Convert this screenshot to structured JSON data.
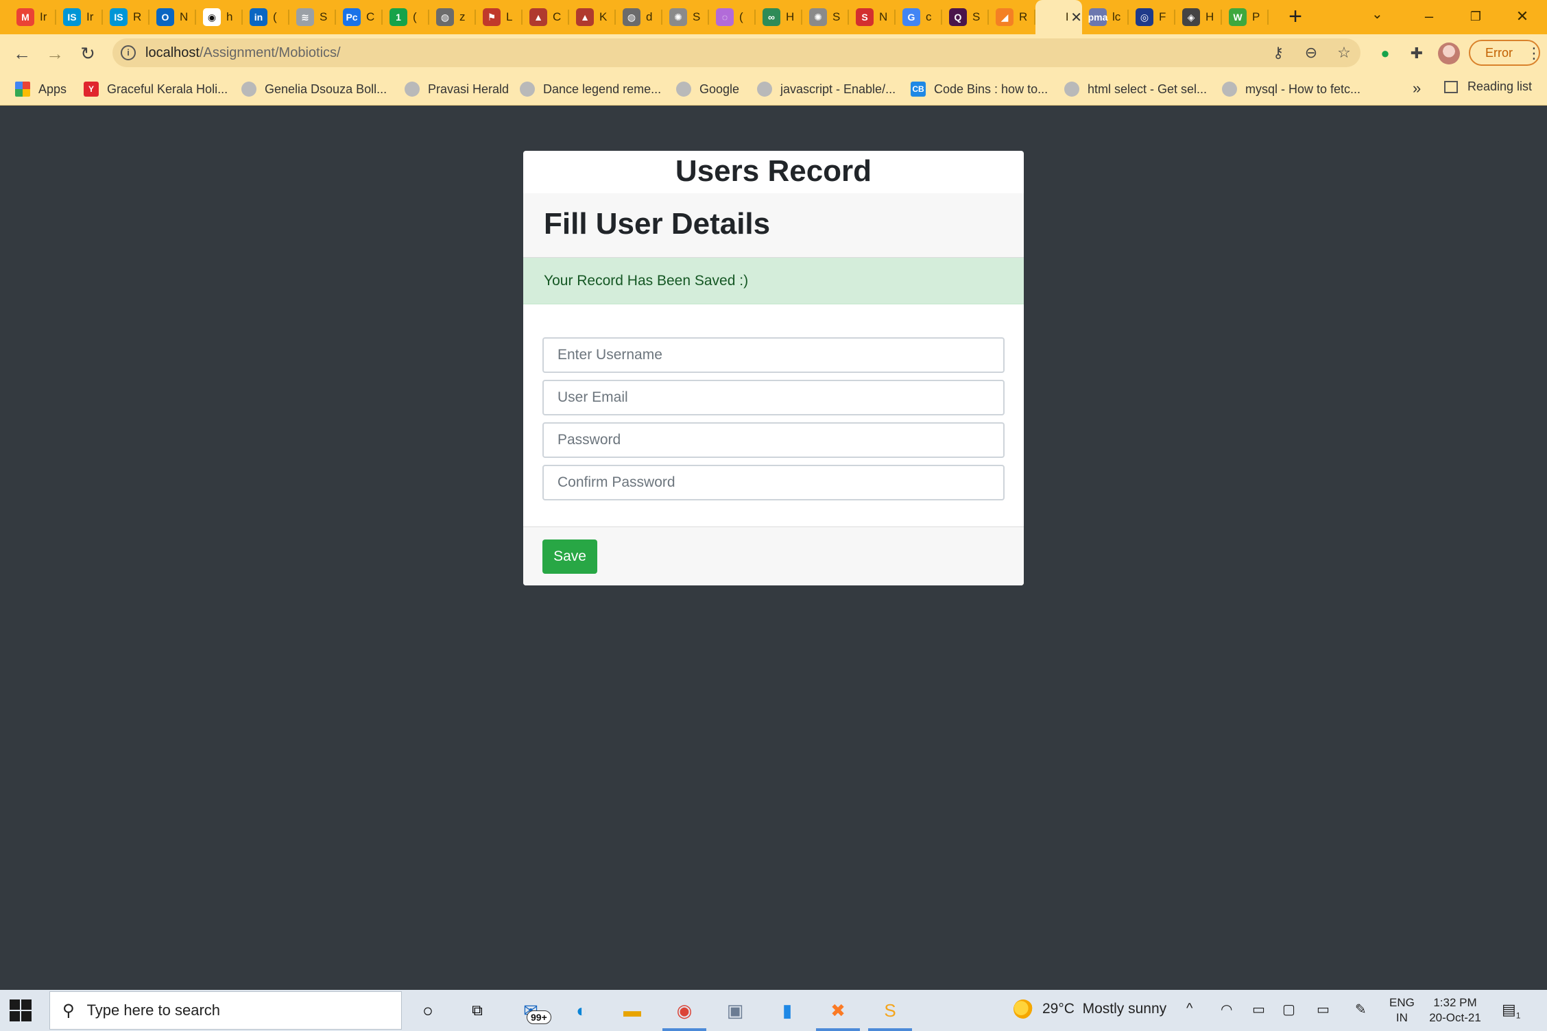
{
  "browser": {
    "tabs": [
      {
        "fav": "M",
        "color": "#ea4335",
        "label": "Ir",
        "icon": "gmail-icon"
      },
      {
        "fav": "IS",
        "color": "#0096d6",
        "label": "Ir",
        "icon": "is-icon"
      },
      {
        "fav": "IS",
        "color": "#0096d6",
        "label": "R",
        "icon": "is-icon"
      },
      {
        "fav": "O",
        "color": "#0a66c2",
        "label": "N",
        "icon": "outlook-icon"
      },
      {
        "fav": "◉",
        "color": "#ffffff",
        "label": "h",
        "icon": "github-icon"
      },
      {
        "fav": "in",
        "color": "#0a66c2",
        "label": "(",
        "icon": "linkedin-icon"
      },
      {
        "fav": "≋",
        "color": "#9aa0a6",
        "label": "S",
        "icon": "site-icon"
      },
      {
        "fav": "Pc",
        "color": "#1a73e8",
        "label": "C",
        "icon": "site-icon"
      },
      {
        "fav": "1",
        "color": "#16a34a",
        "label": "(",
        "icon": "whatsapp-icon"
      },
      {
        "fav": "◍",
        "color": "#6b6b6b",
        "label": "z",
        "icon": "globe-icon"
      },
      {
        "fav": "⚑",
        "color": "#c0392b",
        "label": "L",
        "icon": "site-icon"
      },
      {
        "fav": "▲",
        "color": "#b03a2e",
        "label": "C",
        "icon": "site-icon"
      },
      {
        "fav": "▲",
        "color": "#b03a2e",
        "label": "K",
        "icon": "site-icon"
      },
      {
        "fav": "◍",
        "color": "#6b6b6b",
        "label": "d",
        "icon": "globe-icon"
      },
      {
        "fav": "✺",
        "color": "#8a8a8a",
        "label": "S",
        "icon": "emblem-icon"
      },
      {
        "fav": "◌",
        "color": "#b26bd9",
        "label": "(",
        "icon": "site-icon"
      },
      {
        "fav": "∞",
        "color": "#2e8b57",
        "label": "H",
        "icon": "site-icon"
      },
      {
        "fav": "✺",
        "color": "#8a8a8a",
        "label": "S",
        "icon": "emblem-icon"
      },
      {
        "fav": "S",
        "color": "#d32f2f",
        "label": "N",
        "icon": "site-icon"
      },
      {
        "fav": "G",
        "color": "#4285f4",
        "label": "c",
        "icon": "google-icon"
      },
      {
        "fav": "Q",
        "color": "#4a154b",
        "label": "S",
        "icon": "site-icon"
      },
      {
        "fav": "◢",
        "color": "#f48024",
        "label": "R",
        "icon": "stackoverflow-icon"
      },
      {
        "fav": "",
        "color": "transparent",
        "label": "Re",
        "icon": "page-icon",
        "active": true
      },
      {
        "fav": "pma",
        "color": "#6c78af",
        "label": "lc",
        "icon": "phpmyadmin-icon"
      },
      {
        "fav": "◎",
        "color": "#1e3a8a",
        "label": "F",
        "icon": "site-icon"
      },
      {
        "fav": "◈",
        "color": "#444444",
        "label": "H",
        "icon": "site-icon"
      },
      {
        "fav": "W",
        "color": "#3ea83e",
        "label": "P",
        "icon": "site-icon"
      }
    ],
    "url_host": "localhost",
    "url_path": "/Assignment/Mobiotics/",
    "error_label": "Error",
    "bookmarks": [
      {
        "label": "Apps",
        "icon": "apps-grid-icon"
      },
      {
        "label": "Graceful Kerala Holi...",
        "icon": "yahoo-icon"
      },
      {
        "label": "Genelia Dsouza Boll...",
        "icon": "globe-icon"
      },
      {
        "label": "Pravasi Herald",
        "icon": "globe-icon"
      },
      {
        "label": "Dance legend reme...",
        "icon": "globe-icon"
      },
      {
        "label": "Google",
        "icon": "globe-icon"
      },
      {
        "label": "javascript - Enable/...",
        "icon": "globe-icon"
      },
      {
        "label": "Code Bins : how to...",
        "icon": "codebins-icon"
      },
      {
        "label": "html select - Get sel...",
        "icon": "globe-icon"
      },
      {
        "label": "mysql - How to fetc...",
        "icon": "globe-icon"
      }
    ],
    "reading_list": "Reading list"
  },
  "page": {
    "title": "Users Record",
    "card_header": "Fill User Details",
    "alert": "Your Record Has Been Saved :)",
    "fields": {
      "username_placeholder": "Enter Username",
      "email_placeholder": "User Email",
      "password_placeholder": "Password",
      "confirm_placeholder": "Confirm Password"
    },
    "save_label": "Save",
    "colors": {
      "background": "#343a40",
      "save_button": "#28a745",
      "alert_bg": "#d4edda",
      "alert_text": "#155724"
    }
  },
  "taskbar": {
    "search_placeholder": "Type here to search",
    "mail_badge": "99+",
    "weather_temp": "29°C",
    "weather_desc": "Mostly sunny",
    "lang_top": "ENG",
    "lang_bottom": "IN",
    "time": "1:32 PM",
    "date": "20-Oct-21",
    "notification_count": "1"
  }
}
